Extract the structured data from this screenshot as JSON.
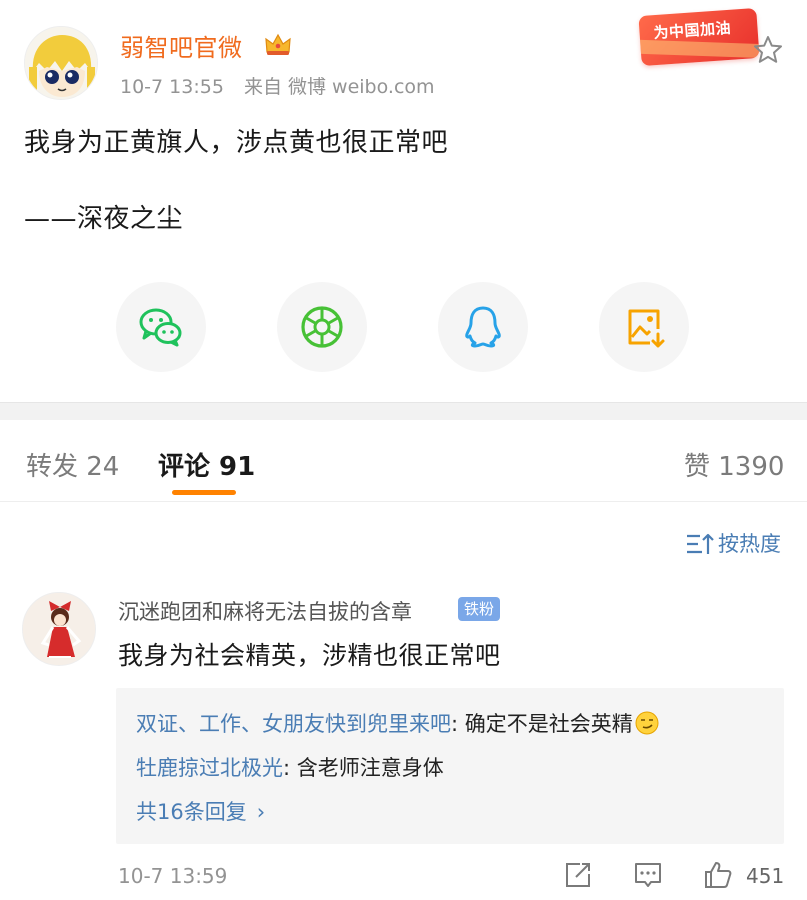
{
  "post": {
    "author": "弱智吧官微",
    "time": "10-7 13:55",
    "source": "来自 微博 weibo.com",
    "banner_text": "为中国加油",
    "lines": [
      "我身为正黄旗人，涉点黄也很正常吧",
      "——深夜之尘"
    ],
    "share_icons": [
      "wechat-icon",
      "moments-icon",
      "qq-icon",
      "save-image-icon"
    ]
  },
  "tabs": {
    "repost": "转发 24",
    "comments": "评论 91",
    "likes": "赞 1390"
  },
  "sort": {
    "label": "按热度"
  },
  "comment": {
    "user": "沉迷跑团和麻将无法自拔的含章",
    "badge": "铁粉",
    "text": "我身为社会精英，涉精也很正常吧",
    "replies": [
      {
        "who": "双证、工作、女朋友快到兜里来吧",
        "text": ": 确定不是社会英精"
      },
      {
        "who": "牡鹿掠过北极光",
        "text": ": 含老师注意身体"
      }
    ],
    "more_replies": "共16条回复",
    "time": "10-7 13:59",
    "like_count": "451"
  },
  "colors": {
    "accent": "#ff8200",
    "author_name": "#f06b1e",
    "link": "#4a7db4",
    "badge": "#7aa7e8",
    "wechat": "#1fc25c",
    "moments": "#47c136",
    "qq": "#27a2e8",
    "save": "#f7a300"
  }
}
